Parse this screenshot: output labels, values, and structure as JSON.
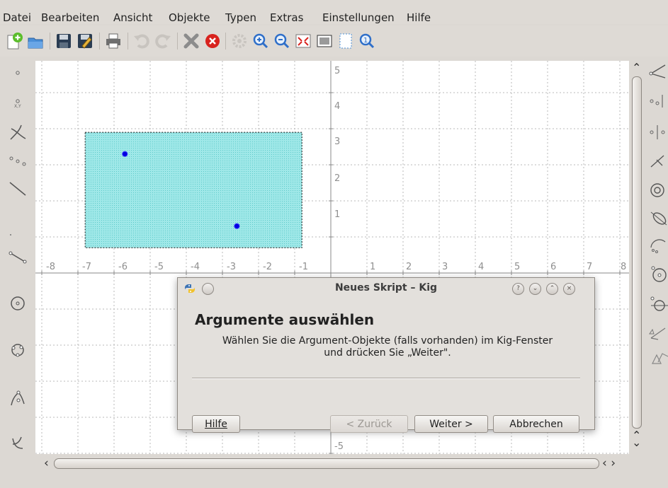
{
  "menu": {
    "items": [
      "Datei",
      "Bearbeiten",
      "Ansicht",
      "Objekte",
      "Typen",
      "Extras",
      "Einstellungen",
      "Hilfe"
    ]
  },
  "toolbar": {
    "icons": [
      "new-document-icon",
      "open-folder-icon",
      "save-icon",
      "save-as-icon",
      "print-icon",
      "undo-icon",
      "redo-icon",
      "delete-icon",
      "cancel-icon",
      "settings-icon",
      "zoom-in-icon",
      "zoom-out-icon",
      "fit-to-page-icon",
      "screenshot-icon",
      "select-window-icon",
      "show-hidden-icon"
    ]
  },
  "left_tools": {
    "icons": [
      "point-icon",
      "point-by-coordinates-icon",
      "intersection-icon",
      "midpoint-icon",
      "line-icon",
      "ray-icon",
      "segment-icon",
      "circle-icon",
      "circle-by-three-points-icon",
      "locus-icon",
      "conic-icon"
    ]
  },
  "right_tools": {
    "icons": [
      "angle-icon",
      "three-points-icon",
      "parallel-icon",
      "perpendicular-icon",
      "spiral-icon",
      "conic-by-points-icon",
      "arc-icon",
      "circle-center-icon",
      "tangent-icon",
      "vector-icon",
      "transform-icon"
    ]
  },
  "axes": {
    "x_ticks": [
      "-8",
      "-7",
      "-6",
      "-5",
      "-4",
      "-3",
      "-2",
      "-1",
      "1",
      "2",
      "3",
      "4",
      "5",
      "6",
      "7",
      "8"
    ],
    "y_ticks": [
      "5",
      "4",
      "3",
      "2",
      "1"
    ],
    "y_tick_hidden": "-5"
  },
  "selection": {
    "fill": "#9fe8e8",
    "points": [
      {
        "x": -5.7,
        "y": 3.3
      },
      {
        "x": -2.6,
        "y": 1.3
      }
    ],
    "x_range": [
      -6.8,
      -0.8
    ],
    "y_range": [
      0.7,
      3.9
    ]
  },
  "dialog": {
    "title": "Neues Skript – Kig",
    "heading": "Argumente auswählen",
    "body_line1": "Wählen Sie die Argument-Objekte (falls vorhanden) im Kig-Fenster",
    "body_line2": "und drücken Sie „Weiter\".",
    "buttons": {
      "help": "Hilfe",
      "back": "< Zurück",
      "next": "Weiter >",
      "cancel": "Abbrechen"
    }
  },
  "scrollbars": {
    "up_arrow": "⌃",
    "down_arrow": "⌄",
    "left_arrow": "‹",
    "right_arrows": "‹ ›"
  },
  "colors": {
    "canvas": "#ffffff",
    "grid": "#b8b8b8",
    "axis": "#888888",
    "point": "#0000e0",
    "accent": "#2f6fc9"
  }
}
